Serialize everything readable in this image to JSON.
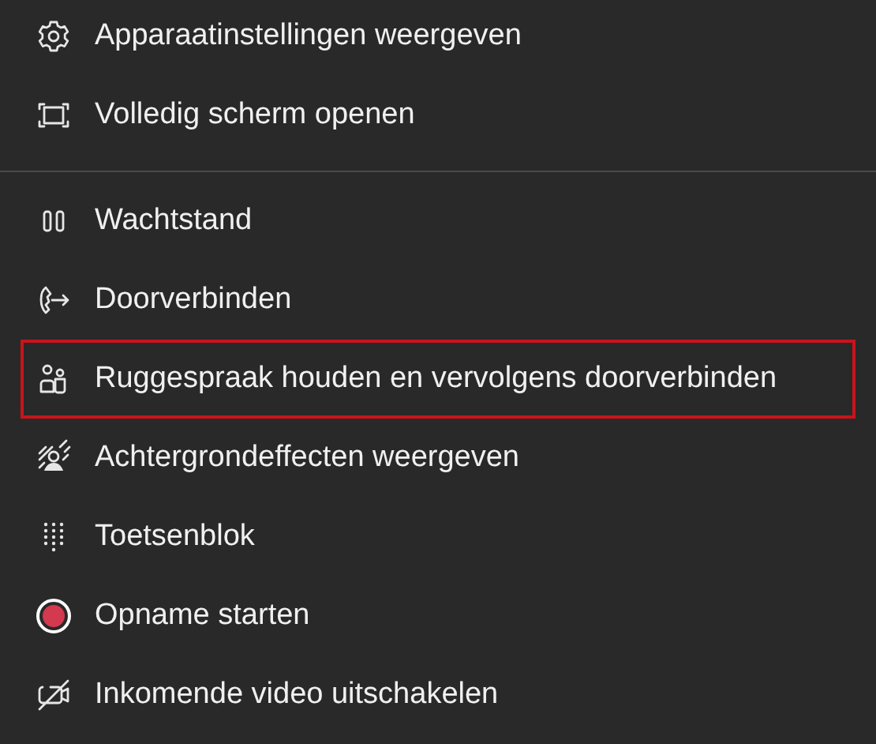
{
  "sections": [
    {
      "items": [
        {
          "kind": "settings",
          "label": "Apparaatinstellingen weergeven",
          "highlighted": false
        },
        {
          "kind": "fullscreen",
          "label": "Volledig scherm openen",
          "highlighted": false
        }
      ]
    },
    {
      "items": [
        {
          "kind": "hold",
          "label": "Wachtstand",
          "highlighted": false
        },
        {
          "kind": "transfer",
          "label": "Doorverbinden",
          "highlighted": false
        },
        {
          "kind": "consult",
          "label": "Ruggespraak houden en vervolgens doorverbinden",
          "highlighted": true
        },
        {
          "kind": "background",
          "label": "Achtergrondeffecten weergeven",
          "highlighted": false
        },
        {
          "kind": "keypad",
          "label": "Toetsenblok",
          "highlighted": false
        },
        {
          "kind": "record",
          "label": "Opname starten",
          "highlighted": false
        },
        {
          "kind": "video-off",
          "label": "Inkomende video uitschakelen",
          "highlighted": false
        }
      ]
    }
  ]
}
